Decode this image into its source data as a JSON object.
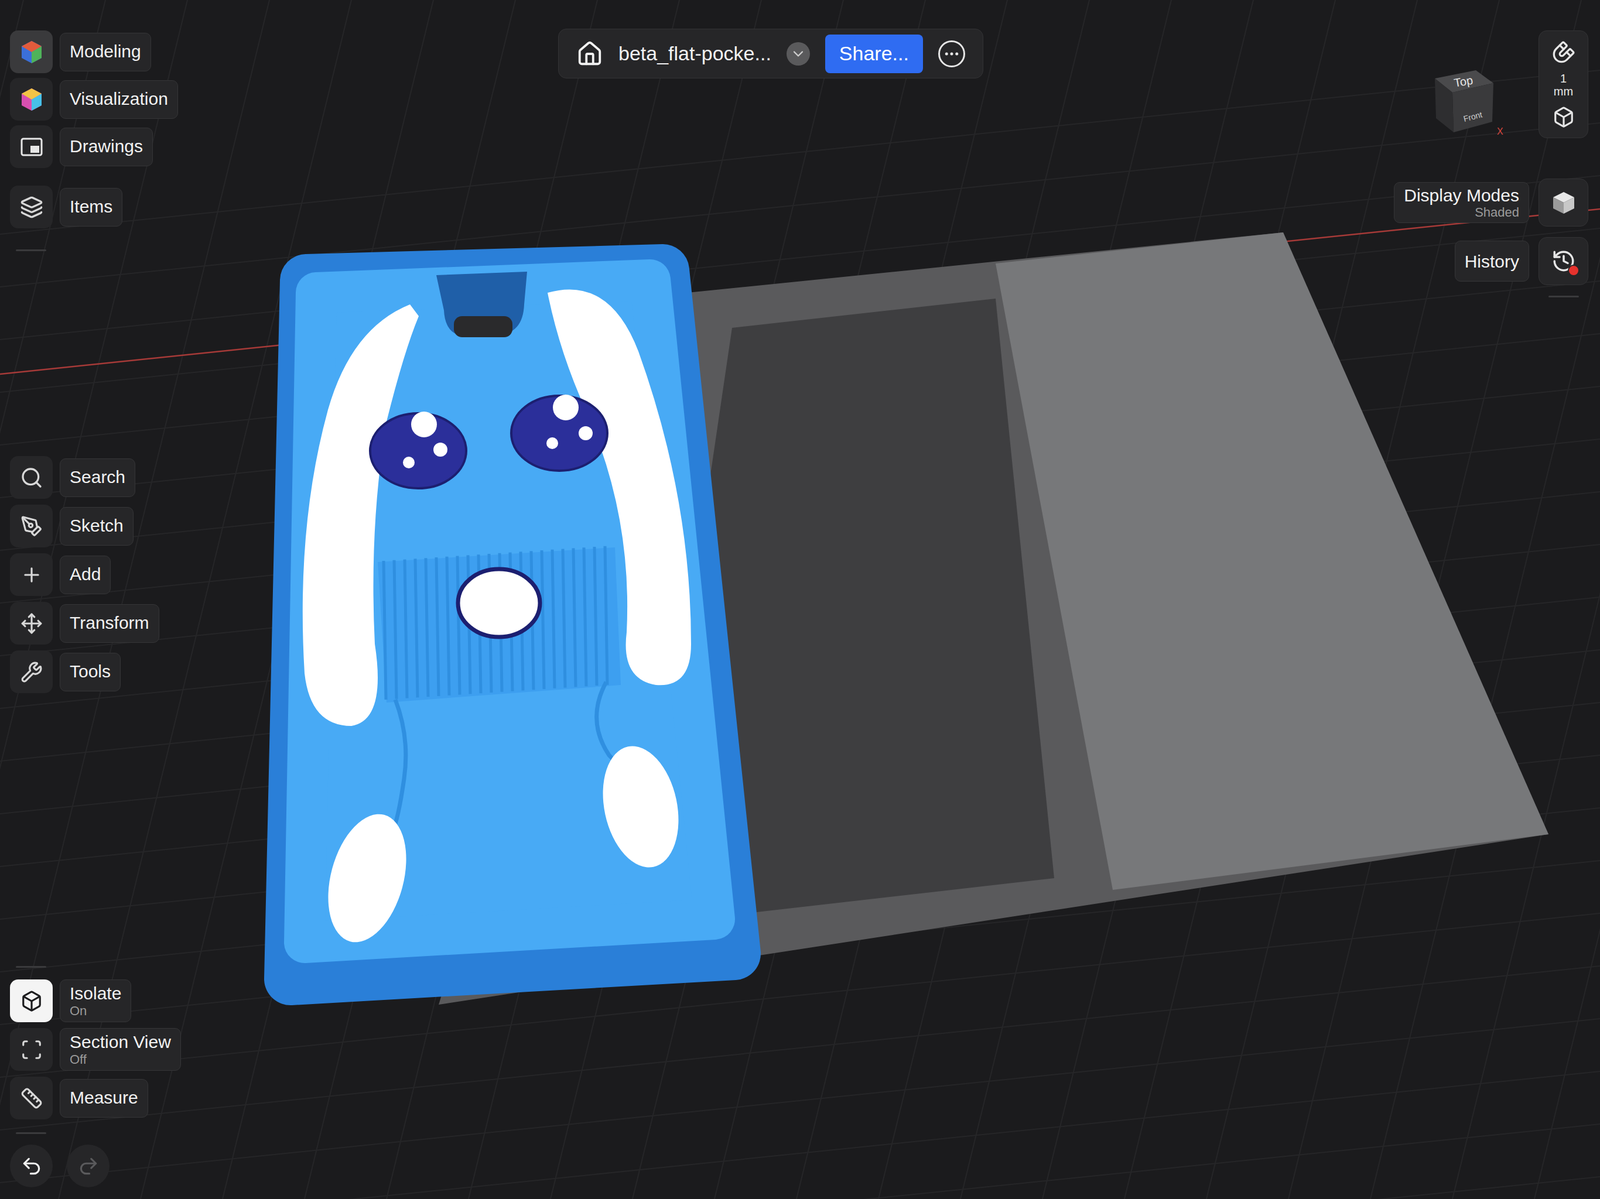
{
  "document": {
    "title": "beta_flat-pocke...",
    "share_button": "Share..."
  },
  "modes": [
    {
      "label": "Modeling",
      "selected": true
    },
    {
      "label": "Visualization",
      "selected": false
    },
    {
      "label": "Drawings",
      "selected": false
    }
  ],
  "items_button": {
    "label": "Items"
  },
  "tools": [
    {
      "label": "Search"
    },
    {
      "label": "Sketch"
    },
    {
      "label": "Add"
    },
    {
      "label": "Transform"
    },
    {
      "label": "Tools"
    }
  ],
  "view_toggles": [
    {
      "label": "Isolate",
      "value": "On",
      "on": true
    },
    {
      "label": "Section View",
      "value": "Off",
      "on": false
    },
    {
      "label": "Measure",
      "value": "",
      "on": false
    }
  ],
  "snap": {
    "value": "1",
    "unit": "mm"
  },
  "view_cube": {
    "top": "Top",
    "front": "Front",
    "axis": "X"
  },
  "display_modes": {
    "label": "Display Modes",
    "value": "Shaded"
  },
  "history": {
    "label": "History",
    "alert": true
  },
  "undo": {
    "enabled": true
  },
  "redo": {
    "enabled": false
  }
}
